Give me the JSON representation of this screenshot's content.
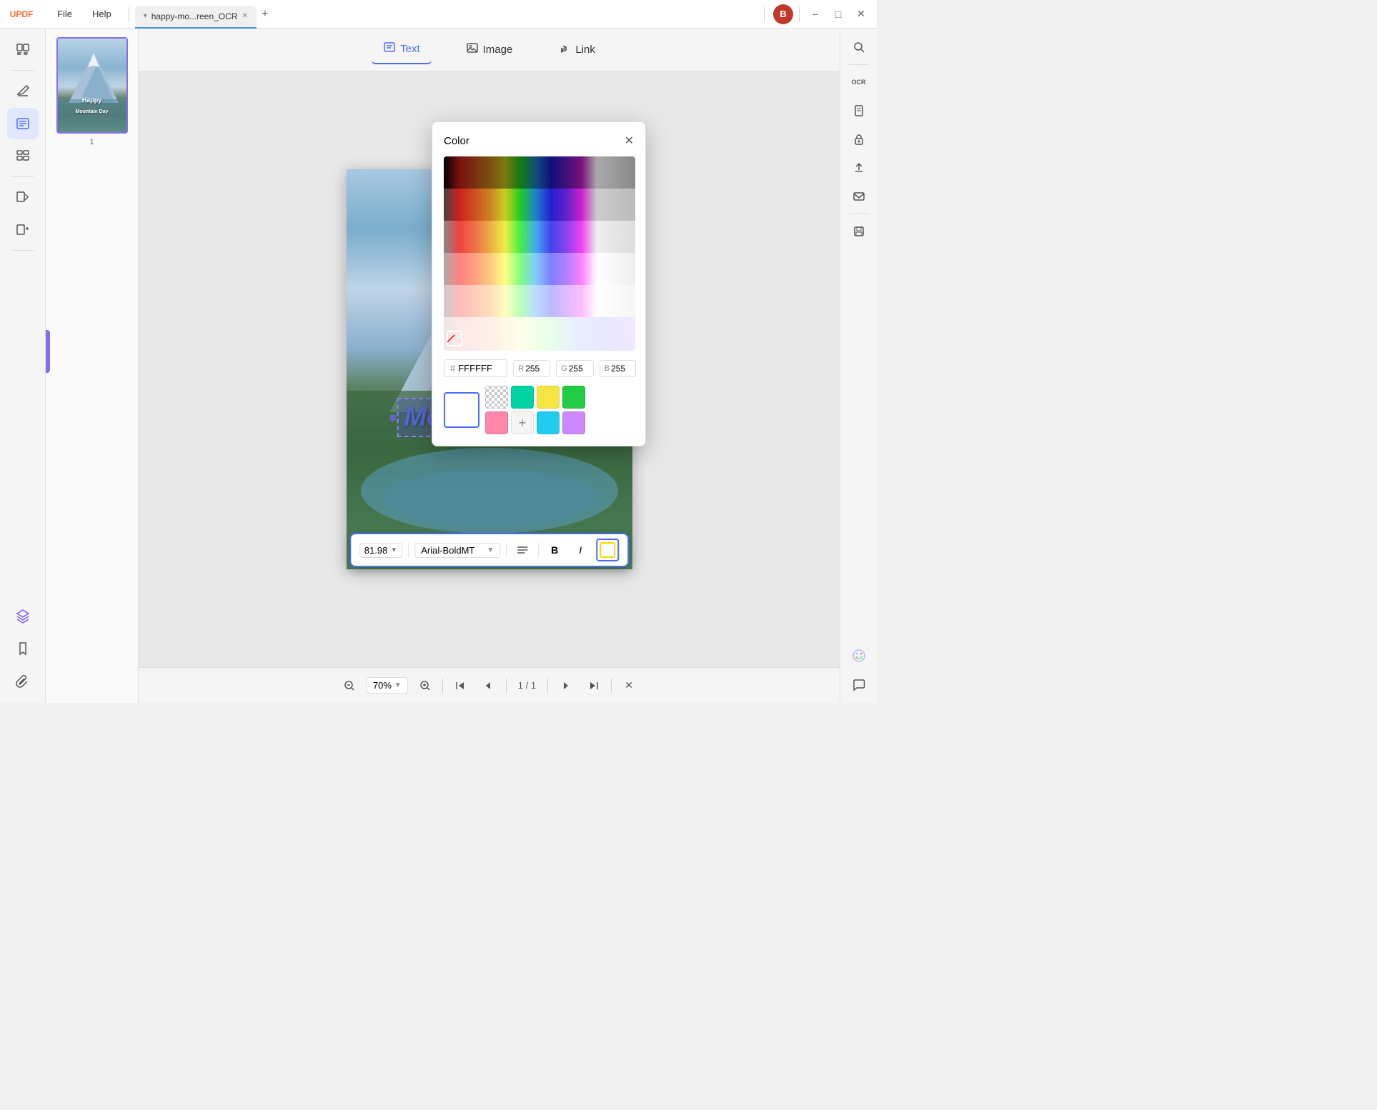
{
  "titlebar": {
    "logo": "UPDF",
    "menu": [
      "File",
      "Help"
    ],
    "tab_name": "happy-mo...reen_OCR",
    "tab_dropdown": "▾",
    "user_avatar": "B",
    "controls": [
      "−",
      "□",
      "✕"
    ]
  },
  "toolbar": {
    "text_label": "Text",
    "image_label": "Image",
    "link_label": "Link"
  },
  "left_sidebar": {
    "icons": [
      {
        "name": "reader-icon",
        "symbol": "📖",
        "active": false
      },
      {
        "name": "edit-icon",
        "symbol": "✏️",
        "active": false
      },
      {
        "name": "annotate-icon",
        "symbol": "📝",
        "active": true
      },
      {
        "name": "organize-icon",
        "symbol": "☰",
        "active": false
      },
      {
        "name": "convert-icon",
        "symbol": "⚙️",
        "active": false
      },
      {
        "name": "extract-icon",
        "symbol": "📤",
        "active": false
      },
      {
        "name": "layers-icon",
        "symbol": "◧",
        "active": false
      },
      {
        "name": "bookmark-icon",
        "symbol": "🔖",
        "active": false
      },
      {
        "name": "attach-icon",
        "symbol": "📎",
        "active": false
      }
    ]
  },
  "right_sidebar": {
    "icons": [
      {
        "name": "search-icon",
        "symbol": "🔍"
      },
      {
        "name": "ocr-icon",
        "symbol": "OCR"
      },
      {
        "name": "document-icon",
        "symbol": "📄"
      },
      {
        "name": "lock-icon",
        "symbol": "🔒"
      },
      {
        "name": "share-icon",
        "symbol": "⬆"
      },
      {
        "name": "mail-icon",
        "symbol": "✉"
      },
      {
        "name": "save-icon",
        "symbol": "💾"
      },
      {
        "name": "apps-icon",
        "symbol": "✳"
      },
      {
        "name": "chat-icon",
        "symbol": "💬"
      }
    ]
  },
  "thumbnail": {
    "page_num": "1",
    "happy_text": "Happy",
    "mountain_day_text": "Mountain Day"
  },
  "text_toolbar": {
    "font_size": "81.98",
    "font_name": "Arial-BoldMT",
    "align_icon": "≡",
    "bold_label": "B",
    "italic_label": "I"
  },
  "bottom_bar": {
    "zoom_level": "70%",
    "page_current": "1",
    "page_total": "1",
    "zoom_in": "+",
    "zoom_out": "−"
  },
  "color_picker": {
    "title": "Color",
    "close": "✕",
    "hex_label": "#",
    "hex_value": "FFFFFF",
    "r_label": "R",
    "r_value": "255",
    "g_label": "G",
    "g_value": "255",
    "b_label": "B",
    "b_value": "255",
    "swatches": [
      {
        "color": "transparent",
        "name": "transparent-swatch"
      },
      {
        "color": "#00d4a4",
        "name": "teal-swatch"
      },
      {
        "color": "#f5e642",
        "name": "yellow-swatch"
      },
      {
        "color": "#22cc44",
        "name": "green-swatch"
      },
      {
        "color": "#22ccee",
        "name": "cyan-swatch"
      },
      {
        "color": "#cc88ff",
        "name": "purple-swatch"
      },
      {
        "color": "#ff88aa",
        "name": "pink-swatch"
      },
      {
        "color": "#aaaaaa",
        "name": "add-swatch"
      }
    ],
    "selected_color": "#FFFFFF"
  },
  "pdf": {
    "happy_text": "Happy",
    "mountain_text": "Mountain",
    "day_text": " Day"
  }
}
